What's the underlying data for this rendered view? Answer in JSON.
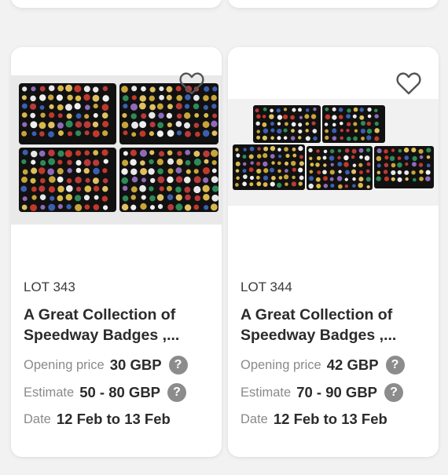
{
  "lots": [
    {
      "lot_label": "LOT 343",
      "title": "A Great Collection of Speedway Badges ,...",
      "opening_price_label": "Opening price",
      "opening_price": "30 GBP",
      "estimate_label": "Estimate",
      "estimate": "50 - 80 GBP",
      "date_label": "Date",
      "date": "12 Feb to 13 Feb"
    },
    {
      "lot_label": "LOT 344",
      "title": "A Great Collection of Speedway Badges ,...",
      "opening_price_label": "Opening price",
      "opening_price": "42 GBP",
      "estimate_label": "Estimate",
      "estimate": "70 - 90 GBP",
      "date_label": "Date",
      "date": "12 Feb to 13 Feb"
    }
  ],
  "help_glyph": "?",
  "icons": {
    "favorite": "heart-outline-icon",
    "help": "question-circle-icon"
  },
  "colors": {
    "background": "#f2f2f2",
    "card": "#ffffff",
    "help_circle": "#8c8c8c",
    "tray": "#111111"
  }
}
